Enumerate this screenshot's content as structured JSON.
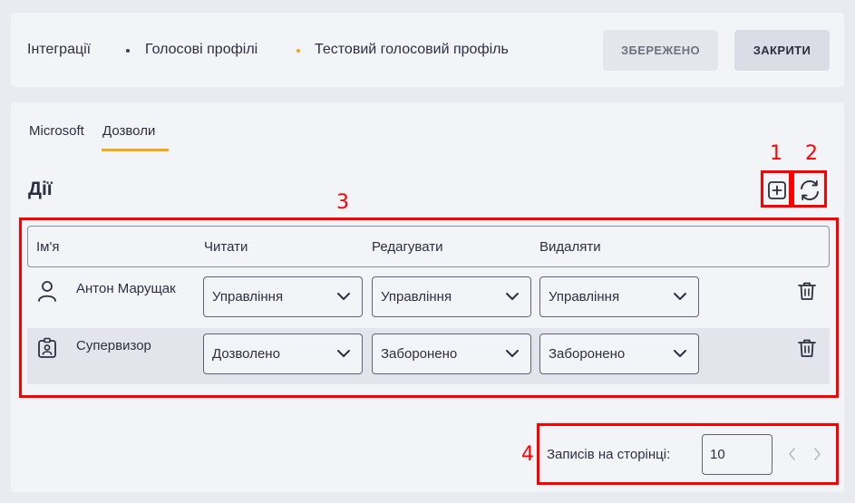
{
  "breadcrumb": {
    "items": [
      "Інтеграції",
      "Голосові профілі",
      "Тестовий голосовий профіль"
    ],
    "separator_colors": [
      "#3a3d55",
      "#f1a915"
    ]
  },
  "header_buttons": {
    "saved_label": "ЗБЕРЕЖЕНО",
    "close_label": "ЗАКРИТИ"
  },
  "tabs": [
    {
      "label": "Microsoft",
      "active": false
    },
    {
      "label": "Дозволи",
      "active": true
    }
  ],
  "section": {
    "title": "Дії"
  },
  "toolbar_icons": [
    "plus-square-icon",
    "refresh-icon"
  ],
  "annotations": [
    "1",
    "2",
    "3",
    "4"
  ],
  "table": {
    "columns": [
      "Ім'я",
      "Читати",
      "Редагувати",
      "Видаляти"
    ],
    "rows": [
      {
        "icon": "user-icon",
        "name": "Антон Марущак",
        "read": "Управління",
        "edit": "Управління",
        "delete": "Управління"
      },
      {
        "icon": "badge-icon",
        "name": "Супервизор",
        "read": "Дозволено",
        "edit": "Заборонено",
        "delete": "Заборонено"
      }
    ]
  },
  "pagination": {
    "label": "Записів на сторінці:",
    "per_page": "10"
  },
  "colors": {
    "accent": "#f1a915",
    "annotation": "#ff0000"
  }
}
